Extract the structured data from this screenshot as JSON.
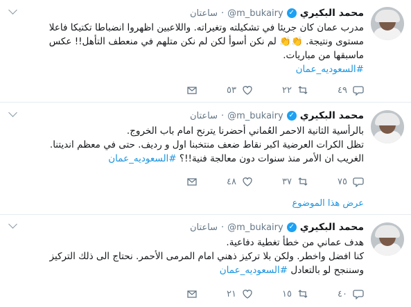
{
  "tweets": [
    {
      "author_name": "محمد البكيري",
      "handle": "@m_bukairy",
      "separator": "·",
      "time": "ساعتان",
      "lines": [
        "مدرب عمان كان جريئا في تشكيلته وتغيراته. واللاعبين اظهروا انضباطا تكتيكا فاعلا",
        "مستوى ونتيجة.",
        "لم نكن أسوأ لكن لم نكن متلهم في منعطف التأهل!! عكس",
        "ماسبقها من مباريات."
      ],
      "emoji": "👏👏",
      "hashtag": "#السعوديه_عمان",
      "reply_count": "٤٩",
      "retweet_count": "٢٢",
      "like_count": "٥٣",
      "thread_link": ""
    },
    {
      "author_name": "محمد البكيري",
      "handle": "@m_bukairy",
      "separator": "·",
      "time": "ساعتان",
      "lines": [
        "بالرأسية الثانية الاحمر العُماني أحضرنا يترنح امام باب الخروج.",
        "تظل الكرات العرضية اكبر نقاط ضعف منتخبنا اول و رديف. حتى في معظم انديتنا.",
        "الغريب ان الأمر منذ سنوات دون معالجة فنية!!؟"
      ],
      "hashtag": "#السعوديه_عمان",
      "reply_count": "٧٥",
      "retweet_count": "٣٧",
      "like_count": "٤٨",
      "thread_link": "عرض هذا الموضوع"
    },
    {
      "author_name": "محمد البكيري",
      "handle": "@m_bukairy",
      "separator": "·",
      "time": "ساعتان",
      "lines": [
        "هدف عماني من خطأ تغطية دفاعية.",
        "كنا افضل واخطر. ولكن بلا تركيز ذهني امام المرمى الأحمر. نحتاج الى ذلك التركيز",
        "وسننجح لو بالتعادل"
      ],
      "hashtag": "#السعوديه_عمان",
      "reply_count": "٤٠",
      "retweet_count": "١٥",
      "like_count": "٢١",
      "thread_link": ""
    }
  ],
  "icons": {
    "reply": "reply-icon",
    "retweet": "retweet-icon",
    "like": "heart-icon",
    "dm": "envelope-icon",
    "verified": "verified-badge-icon",
    "more": "chevron-down-icon"
  },
  "colors": {
    "hashtag": "#1b95e0",
    "verified": "#1da1f2",
    "secondary_text": "#657786",
    "divider": "#e6ecf0"
  }
}
